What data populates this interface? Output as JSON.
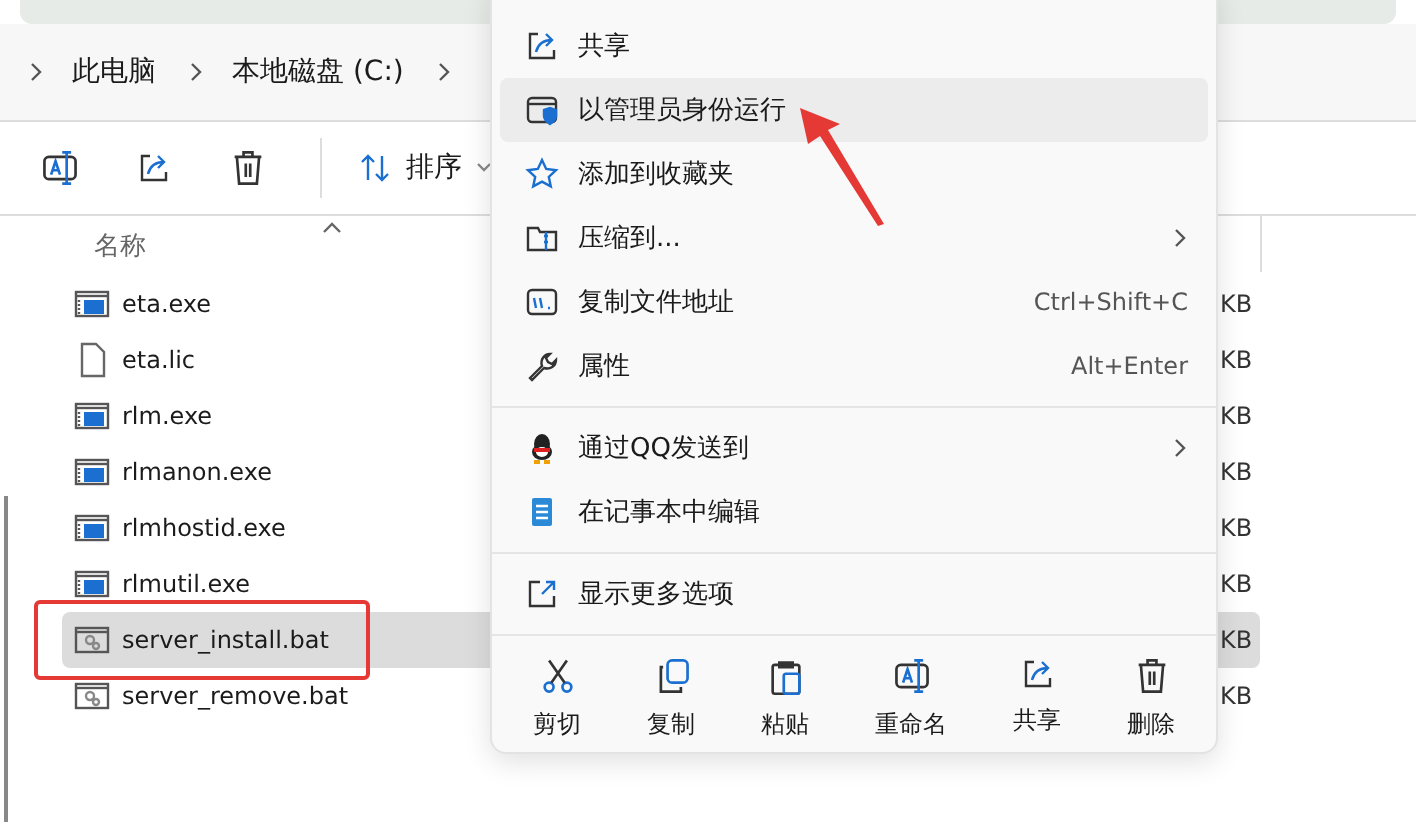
{
  "breadcrumb": [
    "此电脑",
    "本地磁盘 (C:)"
  ],
  "toolbar": {
    "sort_label": "排序"
  },
  "column_header": "名称",
  "files": [
    {
      "name": "eta.exe",
      "kind": "exe",
      "selected": false,
      "size": "KB"
    },
    {
      "name": "eta.lic",
      "kind": "file",
      "selected": false,
      "size": "KB"
    },
    {
      "name": "rlm.exe",
      "kind": "exe",
      "selected": false,
      "size": "KB"
    },
    {
      "name": "rlmanon.exe",
      "kind": "exe",
      "selected": false,
      "size": "KB"
    },
    {
      "name": "rlmhostid.exe",
      "kind": "exe",
      "selected": false,
      "size": "KB"
    },
    {
      "name": "rlmutil.exe",
      "kind": "exe",
      "selected": false,
      "size": "KB"
    },
    {
      "name": "server_install.bat",
      "kind": "bat",
      "selected": true,
      "size": "KB"
    },
    {
      "name": "server_remove.bat",
      "kind": "bat",
      "selected": false,
      "size": "KB"
    }
  ],
  "context_menu": {
    "sections": [
      [
        {
          "label": "共享",
          "kind": "share",
          "selected": false
        },
        {
          "label": "以管理员身份运行",
          "kind": "admin",
          "selected": true
        },
        {
          "label": "添加到收藏夹",
          "kind": "favorite",
          "selected": false
        },
        {
          "label": "压缩到...",
          "kind": "compress",
          "selected": false,
          "submenu": true
        },
        {
          "label": "复制文件地址",
          "kind": "copy-path",
          "selected": false,
          "shortcut": "Ctrl+Shift+C"
        },
        {
          "label": "属性",
          "kind": "properties",
          "selected": false,
          "shortcut": "Alt+Enter"
        }
      ],
      [
        {
          "label": "通过QQ发送到",
          "kind": "qq",
          "selected": false,
          "submenu": true
        },
        {
          "label": "在记事本中编辑",
          "kind": "notepad",
          "selected": false
        }
      ],
      [
        {
          "label": "显示更多选项",
          "kind": "more",
          "selected": false
        }
      ]
    ],
    "actions": [
      {
        "label": "剪切",
        "kind": "cut"
      },
      {
        "label": "复制",
        "kind": "copy"
      },
      {
        "label": "粘贴",
        "kind": "paste"
      },
      {
        "label": "重命名",
        "kind": "rename"
      },
      {
        "label": "共享",
        "kind": "share"
      },
      {
        "label": "删除",
        "kind": "delete"
      }
    ]
  }
}
